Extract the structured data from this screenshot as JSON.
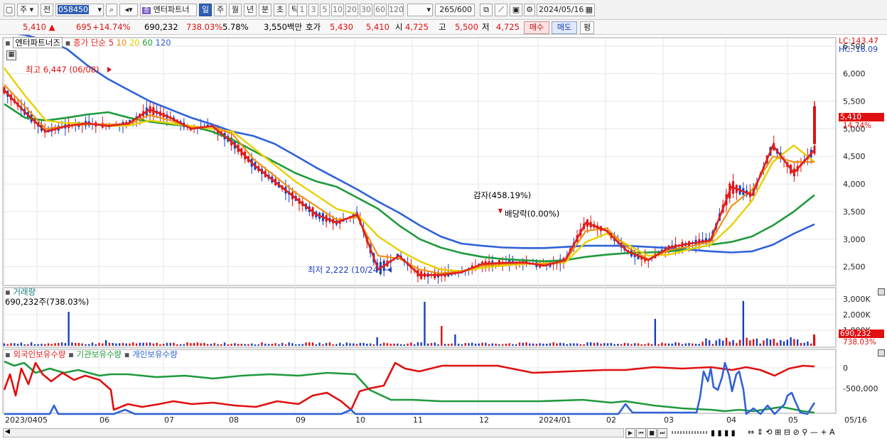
{
  "toolbar": {
    "market": "주",
    "prev": "전",
    "code": "058450",
    "stock_name": "엔터파트너",
    "period_tabs": [
      "일",
      "주",
      "월",
      "년",
      "분",
      "초",
      "틱"
    ],
    "active_period": "일",
    "intervals": [
      "1",
      "3",
      "5",
      "10",
      "20",
      "30",
      "60",
      "120"
    ],
    "count": "265",
    "count_max": "/600",
    "date": "2024/05/16"
  },
  "quote": {
    "price": "5,410",
    "change": "695",
    "change_pct": "+14.74%",
    "volume": "690,232",
    "volume_ratio": "738.03%",
    "turnover": "5.78%",
    "amount": "3,550백만",
    "ask_label": "호가",
    "ask1": "5,430",
    "bid1": "5,410",
    "open_label": "시",
    "open": "4,725",
    "high_label": "고",
    "high": "5,500",
    "low_label": "저",
    "low": "4,725",
    "buy_label": "매수",
    "sell_label": "매도",
    "avg_label": "평"
  },
  "price_panel": {
    "name": "엔터파트너즈",
    "ma_title": "종가 단순",
    "ma_periods": [
      {
        "label": "5",
        "color": "#e02020"
      },
      {
        "label": "10",
        "color": "#f08c00"
      },
      {
        "label": "20",
        "color": "#e8d000"
      },
      {
        "label": "60",
        "color": "#1e9a3c"
      },
      {
        "label": "120",
        "color": "#2f62d8"
      }
    ],
    "lc": "LC:143.47",
    "hc": "HC:-16.09",
    "high_note": "최고 6,447 (06/08)",
    "low_note": "최저 2,222 (10/24)",
    "event1": "감자(458.19%)",
    "event2": "배당락(0.00%)",
    "y_ticks": [
      "6,500",
      "6,000",
      "5,500",
      "5,000",
      "4,500",
      "4,000",
      "3,500",
      "3,000",
      "2,500"
    ],
    "y_values": [
      6500,
      6000,
      5500,
      5000,
      4500,
      4000,
      3500,
      3000,
      2500
    ],
    "price_tag": "5,410",
    "pct_tag": "14.74%"
  },
  "volume_panel": {
    "title": "거래량",
    "value": "690,232주(738.03%)",
    "y_ticks": [
      "3,000K",
      "2,000K",
      "1,000K"
    ],
    "tag": "690,232",
    "tag_pct": "738.03%"
  },
  "holdings_panel": {
    "series": [
      {
        "label": "외국인보유수량",
        "color": "#e02020"
      },
      {
        "label": "기관보유수량",
        "color": "#1e9a3c"
      },
      {
        "label": "개인보유수량",
        "color": "#2f62d8"
      }
    ],
    "y_ticks": [
      "0",
      "-500,000"
    ]
  },
  "x_axis": {
    "labels": [
      "2023/04",
      "05",
      "06",
      "07",
      "08",
      "09",
      "10",
      "11",
      "12",
      "2024/01",
      "02",
      "03",
      "04",
      "05"
    ],
    "right_label": "05/16"
  },
  "chart_data": {
    "type": "line",
    "title": "",
    "y_range": [
      2200,
      6600
    ],
    "ohlc_close_last": 5410,
    "series": [
      {
        "name": "5",
        "values": [
          5700,
          5300,
          4950,
          5050,
          5100,
          5050,
          5100,
          5350,
          5200,
          5000,
          5050,
          4750,
          4350,
          4050,
          3750,
          3450,
          3300,
          3450,
          2450,
          2700,
          2350,
          2350,
          2400,
          2550,
          2570,
          2580,
          2520,
          2620,
          3300,
          3150,
          2780,
          2620,
          2850,
          2920,
          2980,
          3950,
          3800,
          4700,
          4200,
          4620
        ]
      },
      {
        "name": "10",
        "values": [
          5800,
          5400,
          5000,
          5050,
          5080,
          5080,
          5080,
          5250,
          5150,
          5020,
          5050,
          4900,
          4450,
          4150,
          3850,
          3600,
          3350,
          3400,
          2700,
          2650,
          2450,
          2380,
          2420,
          2520,
          2550,
          2560,
          2550,
          2600,
          3150,
          3200,
          2850,
          2640,
          2800,
          2870,
          2950,
          3600,
          3900,
          4500,
          4400,
          4400
        ]
      },
      {
        "name": "20",
        "values": [
          6100,
          5600,
          5150,
          5100,
          5100,
          5050,
          5060,
          5150,
          5100,
          5050,
          5000,
          4950,
          4650,
          4350,
          4050,
          3800,
          3550,
          3450,
          3050,
          2800,
          2600,
          2450,
          2420,
          2480,
          2520,
          2550,
          2560,
          2580,
          2950,
          3100,
          2900,
          2700,
          2720,
          2820,
          2900,
          3250,
          3700,
          4400,
          4700,
          4400
        ]
      },
      {
        "name": "60",
        "values": [
          5450,
          5200,
          5150,
          5200,
          5260,
          5300,
          5200,
          5130,
          5080,
          5050,
          4950,
          4800,
          4600,
          4400,
          4200,
          4050,
          3950,
          3750,
          3550,
          3250,
          3000,
          2850,
          2750,
          2680,
          2640,
          2620,
          2600,
          2620,
          2680,
          2720,
          2750,
          2760,
          2780,
          2820,
          2900,
          2950,
          3050,
          3250,
          3500,
          3800
        ]
      },
      {
        "name": "120",
        "values": [
          6750,
          6700,
          6600,
          6450,
          6150,
          5900,
          5700,
          5500,
          5350,
          5200,
          5080,
          4950,
          4870,
          4730,
          4520,
          4300,
          4100,
          3900,
          3680,
          3480,
          3250,
          3050,
          2920,
          2880,
          2850,
          2840,
          2840,
          2860,
          2880,
          2880,
          2880,
          2860,
          2840,
          2810,
          2780,
          2760,
          2780,
          2900,
          3100,
          3270
        ]
      }
    ]
  }
}
